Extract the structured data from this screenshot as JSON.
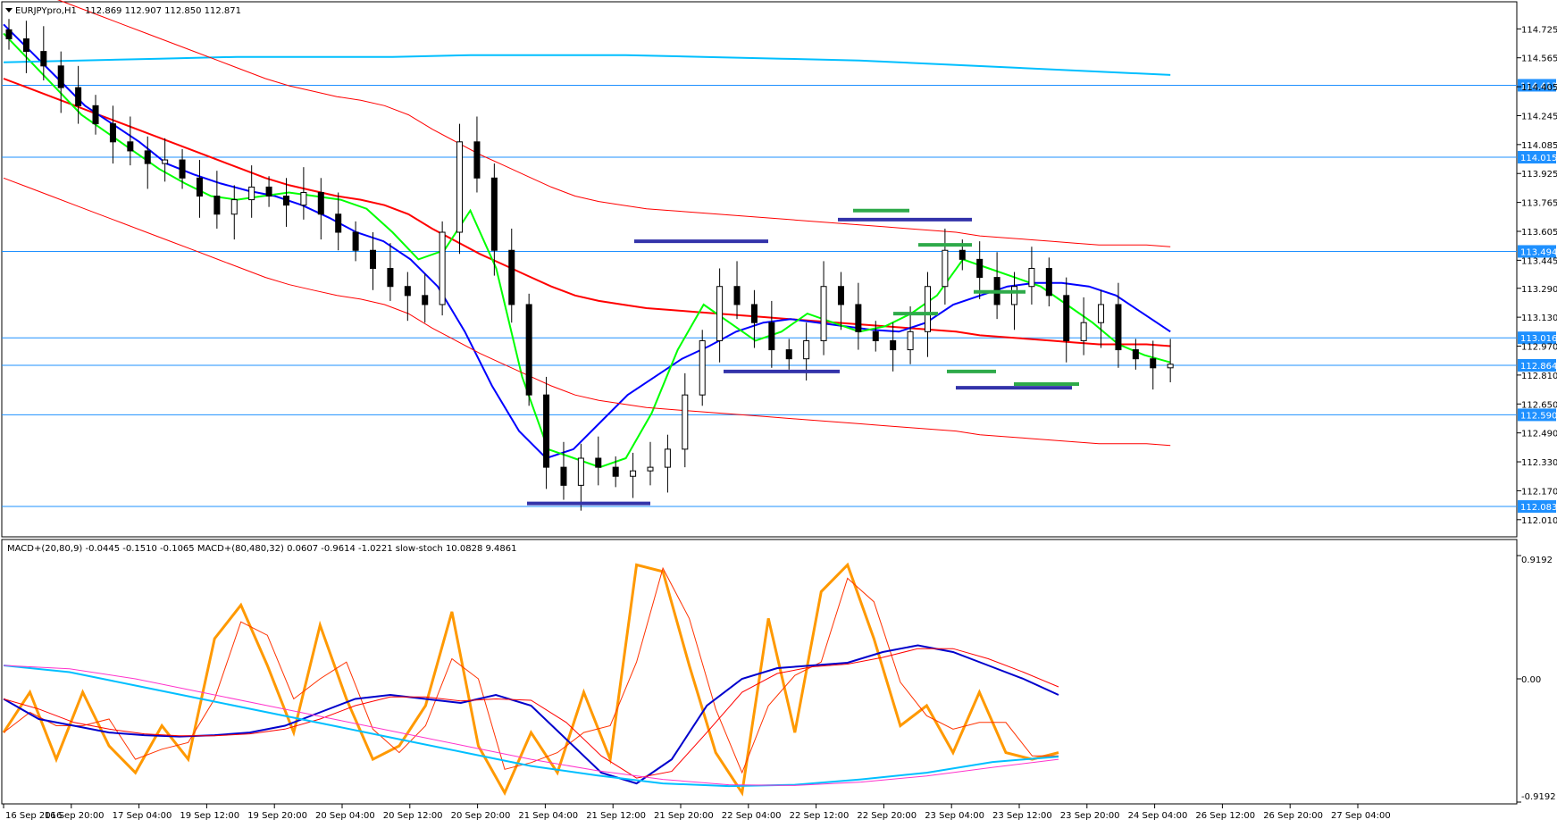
{
  "symbol_header": {
    "symbol": "EURJPYpro,H1",
    "ohlc": "112.869 112.907 112.850 112.871"
  },
  "indicator_header": "MACD+(20,80,9) -0.0445 -0.1510 -0.1065  MACD+(80,480,32) 0.0607 -0.9614 -1.0221  slow-stoch 10.0828 9.4861",
  "colors": {
    "candle_bull_fill": "#ffffff",
    "candle_bear_fill": "#000000",
    "candle_outline": "#000000",
    "ma_red": "#ff0000",
    "ma_blue": "#0000ff",
    "ma_green": "#00ff00",
    "ma_cyan": "#00bfff",
    "envelope": "#ff0000",
    "h_line": "#1e90ff",
    "support_resist_blue": "#3333aa",
    "support_resist_green": "#2eaa4a",
    "stoch_orange": "#ff9900",
    "stoch_red": "#ff3300",
    "macd_blue": "#0000cc",
    "macd_signal_red": "#ff0000",
    "macd_long_cyan": "#00bfff",
    "macd_long_pink": "#ff33cc",
    "label_box": "#1e90ff"
  },
  "chart_data": [
    {
      "type": "candlestick",
      "title": "EURJPYpro,H1",
      "ylim": [
        111.93,
        114.86
      ],
      "price_ticks": [
        "114.725",
        "114.565",
        "114.405",
        "114.245",
        "114.085",
        "113.925",
        "113.765",
        "113.605",
        "113.445",
        "113.290",
        "113.130",
        "112.970",
        "112.810",
        "112.650",
        "112.490",
        "112.330",
        "112.170",
        "112.010"
      ],
      "level_lines": [
        {
          "value": 114.413,
          "label": "114.413"
        },
        {
          "value": 114.015,
          "label": "114.015"
        },
        {
          "value": 113.494,
          "label": "113.494"
        },
        {
          "value": 113.016,
          "label": "113.016"
        },
        {
          "value": 112.864,
          "label": "112.864"
        },
        {
          "value": 112.59,
          "label": "112.590"
        },
        {
          "value": 112.083,
          "label": "112.083"
        }
      ],
      "time_labels": [
        "16 Sep 2016",
        "16 Sep 20:00",
        "17 Sep 04:00",
        "19 Sep 12:00",
        "19 Sep 20:00",
        "20 Sep 04:00",
        "20 Sep 12:00",
        "20 Sep 20:00",
        "21 Sep 04:00",
        "21 Sep 12:00",
        "21 Sep 20:00",
        "22 Sep 04:00",
        "22 Sep 12:00",
        "22 Sep 20:00",
        "23 Sep 04:00",
        "23 Sep 12:00",
        "23 Sep 20:00",
        "24 Sep 04:00",
        "26 Sep 12:00",
        "26 Sep 20:00",
        "27 Sep 04:00"
      ],
      "closes": [
        114.67,
        114.6,
        114.52,
        114.4,
        114.3,
        114.2,
        114.1,
        114.05,
        113.98,
        114.0,
        113.9,
        113.8,
        113.7,
        113.78,
        113.85,
        113.8,
        113.75,
        113.82,
        113.7,
        113.6,
        113.5,
        113.4,
        113.3,
        113.25,
        113.2,
        113.6,
        114.1,
        113.9,
        113.5,
        113.2,
        112.7,
        112.3,
        112.2,
        112.35,
        112.3,
        112.25,
        112.28,
        112.3,
        112.4,
        112.7,
        113.0,
        113.3,
        113.2,
        113.1,
        112.95,
        112.9,
        113.0,
        113.3,
        113.2,
        113.05,
        113.0,
        112.95,
        113.05,
        113.3,
        113.5,
        113.45,
        113.35,
        113.2,
        113.3,
        113.4,
        113.25,
        113.0,
        113.1,
        113.2,
        112.95,
        112.9,
        112.85,
        112.87
      ],
      "series": [
        {
          "name": "MA red",
          "values": [
            114.45,
            114.4,
            114.35,
            114.3,
            114.25,
            114.2,
            114.15,
            114.1,
            114.05,
            114.0,
            113.95,
            113.9,
            113.86,
            113.83,
            113.8,
            113.78,
            113.75,
            113.7,
            113.62,
            113.55,
            113.48,
            113.42,
            113.36,
            113.3,
            113.25,
            113.22,
            113.2,
            113.18,
            113.17,
            113.16,
            113.15,
            113.14,
            113.13,
            113.12,
            113.11,
            113.1,
            113.09,
            113.08,
            113.07,
            113.06,
            113.05,
            113.03,
            113.02,
            113.01,
            113.0,
            112.99,
            112.98,
            112.98,
            112.98,
            112.97
          ]
        },
        {
          "name": "MA blue",
          "values": [
            114.75,
            114.6,
            114.45,
            114.3,
            114.2,
            114.1,
            113.98,
            113.92,
            113.87,
            113.83,
            113.8,
            113.75,
            113.68,
            113.6,
            113.55,
            113.45,
            113.3,
            113.05,
            112.75,
            112.5,
            112.35,
            112.4,
            112.55,
            112.7,
            112.8,
            112.9,
            112.97,
            113.05,
            113.1,
            113.12,
            113.1,
            113.08,
            113.06,
            113.05,
            113.1,
            113.2,
            113.25,
            113.3,
            113.32,
            113.32,
            113.3,
            113.25,
            113.15,
            113.05
          ]
        },
        {
          "name": "MA green",
          "values": [
            114.7,
            114.55,
            114.4,
            114.25,
            114.15,
            114.05,
            113.95,
            113.87,
            113.8,
            113.78,
            113.8,
            113.82,
            113.8,
            113.78,
            113.73,
            113.6,
            113.45,
            113.5,
            113.72,
            113.4,
            112.8,
            112.4,
            112.35,
            112.3,
            112.35,
            112.6,
            112.95,
            113.2,
            113.1,
            113.0,
            113.05,
            113.15,
            113.1,
            113.05,
            113.08,
            113.15,
            113.25,
            113.45,
            113.4,
            113.35,
            113.3,
            113.2,
            113.1,
            112.98,
            112.92,
            112.88
          ]
        },
        {
          "name": "MA cyan",
          "values": [
            114.54,
            114.55,
            114.56,
            114.57,
            114.57,
            114.57,
            114.58,
            114.58,
            114.58,
            114.57,
            114.56,
            114.55,
            114.53,
            114.51,
            114.49,
            114.47
          ]
        }
      ],
      "support_resistance": [
        {
          "color": "blue",
          "value": 113.55
        },
        {
          "color": "blue",
          "value": 112.83
        },
        {
          "color": "blue",
          "value": 112.1
        },
        {
          "color": "blue",
          "value": 113.67
        },
        {
          "color": "blue",
          "value": 112.74
        },
        {
          "color": "green",
          "value": 113.72
        },
        {
          "color": "green",
          "value": 113.53
        },
        {
          "color": "green",
          "value": 113.15
        },
        {
          "color": "green",
          "value": 113.27
        },
        {
          "color": "green",
          "value": 112.83
        },
        {
          "color": "green",
          "value": 112.76
        }
      ]
    },
    {
      "type": "line",
      "title": "MACD+ / slow-stoch",
      "ylim": [
        -0.9192,
        0.9192
      ],
      "y_ticks": [
        "0.9192",
        "0.00",
        "-0.9192"
      ],
      "series": [
        {
          "name": "slow-stoch",
          "values": [
            -0.4,
            -0.1,
            -0.6,
            -0.1,
            -0.5,
            -0.7,
            -0.35,
            -0.6,
            0.3,
            0.55,
            0.1,
            -0.4,
            0.4,
            -0.15,
            -0.6,
            -0.5,
            -0.2,
            0.5,
            -0.5,
            -0.85,
            -0.4,
            -0.7,
            -0.1,
            -0.6,
            0.85,
            0.8,
            0.1,
            -0.55,
            -0.85,
            0.45,
            -0.4,
            0.65,
            0.85,
            0.3,
            -0.35,
            -0.2,
            -0.55,
            -0.1,
            -0.55,
            -0.6,
            -0.55
          ]
        },
        {
          "name": "MACD(20,80,9)",
          "values": [
            -0.15,
            -0.3,
            -0.35,
            -0.4,
            -0.42,
            -0.43,
            -0.42,
            -0.4,
            -0.35,
            -0.25,
            -0.15,
            -0.12,
            -0.15,
            -0.18,
            -0.12,
            -0.2,
            -0.45,
            -0.7,
            -0.78,
            -0.6,
            -0.2,
            0.0,
            0.08,
            0.1,
            0.12,
            0.2,
            0.25,
            0.2,
            0.1,
            0.0,
            -0.12
          ]
        },
        {
          "name": "MACD(80,480,32)",
          "values": [
            0.1,
            0.05,
            -0.05,
            -0.15,
            -0.25,
            -0.35,
            -0.45,
            -0.55,
            -0.65,
            -0.72,
            -0.78,
            -0.8,
            -0.79,
            -0.75,
            -0.7,
            -0.62,
            -0.58
          ]
        }
      ]
    }
  ]
}
